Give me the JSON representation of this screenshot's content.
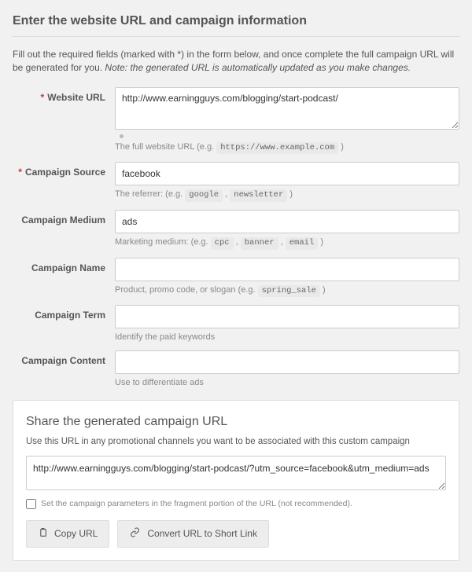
{
  "page_title": "Enter the website URL and campaign information",
  "intro_text": "Fill out the required fields (marked with *) in the form below, and once complete the full campaign URL will be generated for you. ",
  "intro_note": "Note: the generated URL is automatically updated as you make changes.",
  "fields": {
    "website_url": {
      "label": "Website URL",
      "required": true,
      "value": "http://www.earningguys.com/blogging/start-podcast/",
      "hint_pre": "The full website URL (e.g. ",
      "hint_code": "https://www.example.com",
      "hint_post": " )"
    },
    "campaign_source": {
      "label": "Campaign Source",
      "required": true,
      "value": "facebook",
      "hint_pre": "The referrer: (e.g. ",
      "hint_code1": "google",
      "comma": " , ",
      "hint_code2": "newsletter",
      "hint_post": " )"
    },
    "campaign_medium": {
      "label": "Campaign Medium",
      "required": false,
      "value": "ads",
      "hint_pre": "Marketing medium: (e.g. ",
      "hint_code1": "cpc",
      "comma": " , ",
      "hint_code2": "banner",
      "hint_code3": "email",
      "hint_post": " )"
    },
    "campaign_name": {
      "label": "Campaign Name",
      "required": false,
      "value": "",
      "hint_pre": "Product, promo code, or slogan (e.g. ",
      "hint_code": "spring_sale",
      "hint_post": " )"
    },
    "campaign_term": {
      "label": "Campaign Term",
      "required": false,
      "value": "",
      "hint": "Identify the paid keywords"
    },
    "campaign_content": {
      "label": "Campaign Content",
      "required": false,
      "value": "",
      "hint": "Use to differentiate ads"
    }
  },
  "share": {
    "title": "Share the generated campaign URL",
    "desc": "Use this URL in any promotional channels you want to be associated with this custom campaign",
    "generated_url": "http://www.earningguys.com/blogging/start-podcast/?utm_source=facebook&utm_medium=ads",
    "fragment_label": "Set the campaign parameters in the fragment portion of the URL (not recommended).",
    "copy_label": "Copy URL",
    "convert_label": "Convert URL to Short Link"
  }
}
